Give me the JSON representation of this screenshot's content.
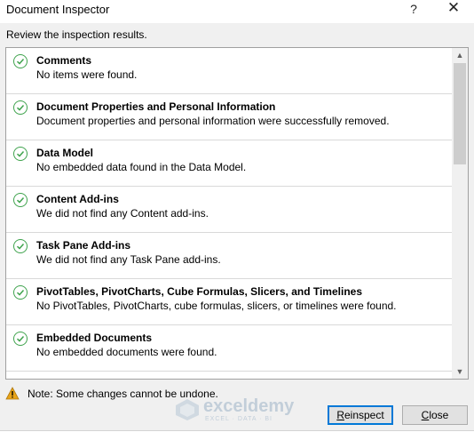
{
  "window": {
    "title": "Document Inspector",
    "help_label": "?",
    "close_label": "✕"
  },
  "subtitle": "Review the inspection results.",
  "results": [
    {
      "name": "Comments",
      "desc": "No items were found."
    },
    {
      "name": "Document Properties and Personal Information",
      "desc": "Document properties and personal information were successfully removed."
    },
    {
      "name": "Data Model",
      "desc": "No embedded data found in the Data Model."
    },
    {
      "name": "Content Add-ins",
      "desc": "We did not find any Content add-ins."
    },
    {
      "name": "Task Pane Add-ins",
      "desc": "We did not find any Task Pane add-ins."
    },
    {
      "name": "PivotTables, PivotCharts, Cube Formulas, Slicers, and Timelines",
      "desc": "No PivotTables, PivotCharts, cube formulas, slicers, or timelines were found."
    },
    {
      "name": "Embedded Documents",
      "desc": "No embedded documents were found."
    }
  ],
  "note": "Note: Some changes cannot be undone.",
  "buttons": {
    "reinspect_first": "R",
    "reinspect_rest": "einspect",
    "close_first": "C",
    "close_rest": "lose"
  },
  "watermark": {
    "name": "exceldemy",
    "tagline": "EXCEL · DATA · BI"
  },
  "colors": {
    "check": "#3fa34d",
    "warning": "#e8a317",
    "focus_border": "#0078d7"
  },
  "icons": {
    "status": "check-circle-icon",
    "warning": "warning-icon"
  }
}
